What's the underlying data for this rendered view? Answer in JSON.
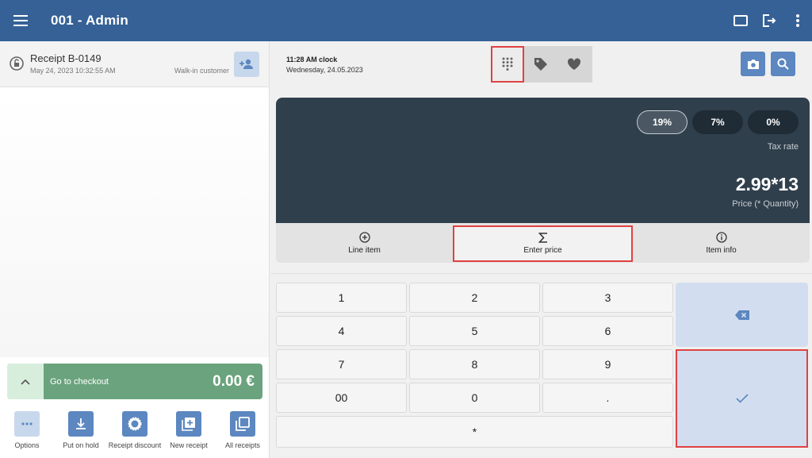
{
  "app": {
    "title": "001 - Admin"
  },
  "receipt": {
    "title": "Receipt B-0149",
    "date": "May 24, 2023 10:32:55 AM",
    "customer": "Walk-in customer"
  },
  "checkout": {
    "label": "Go to checkout",
    "total": "0.00 €"
  },
  "actions": {
    "options": "Options",
    "hold": "Put on hold",
    "discount": "Receipt discount",
    "new_receipt": "New receipt",
    "all_receipts": "All receipts"
  },
  "clock": {
    "time": "11:28 AM clock",
    "date": "Wednesday,  24.05.2023"
  },
  "tax": {
    "rates": [
      "19%",
      "7%",
      "0%"
    ],
    "selected": "19%",
    "label": "Tax rate"
  },
  "price": {
    "value": "2.99*13",
    "label": "Price (* Quantity)"
  },
  "info_tabs": {
    "line_item": "Line item",
    "enter_price": "Enter price",
    "item_info": "Item info"
  },
  "keypad": {
    "k1": "1",
    "k2": "2",
    "k3": "3",
    "k4": "4",
    "k5": "5",
    "k6": "6",
    "k7": "7",
    "k8": "8",
    "k9": "9",
    "k00": "00",
    "k0": "0",
    "kdot": ".",
    "kstar": "*"
  },
  "colors": {
    "topbar": "#356196",
    "display": "#303f4c",
    "checkout": "#6aa37d",
    "accent_button": "#5c87c0",
    "highlight": "#e04141"
  },
  "icons": {
    "menu": "hamburger-menu-icon",
    "tablet": "tablet-icon",
    "logout": "logout-icon",
    "more": "more-vertical-icon",
    "keypad": "dialpad-icon",
    "tag": "tag-icon",
    "favorite": "heart-icon",
    "camera": "camera-icon",
    "search": "search-icon",
    "backspace": "backspace-icon",
    "confirm": "check-icon"
  }
}
